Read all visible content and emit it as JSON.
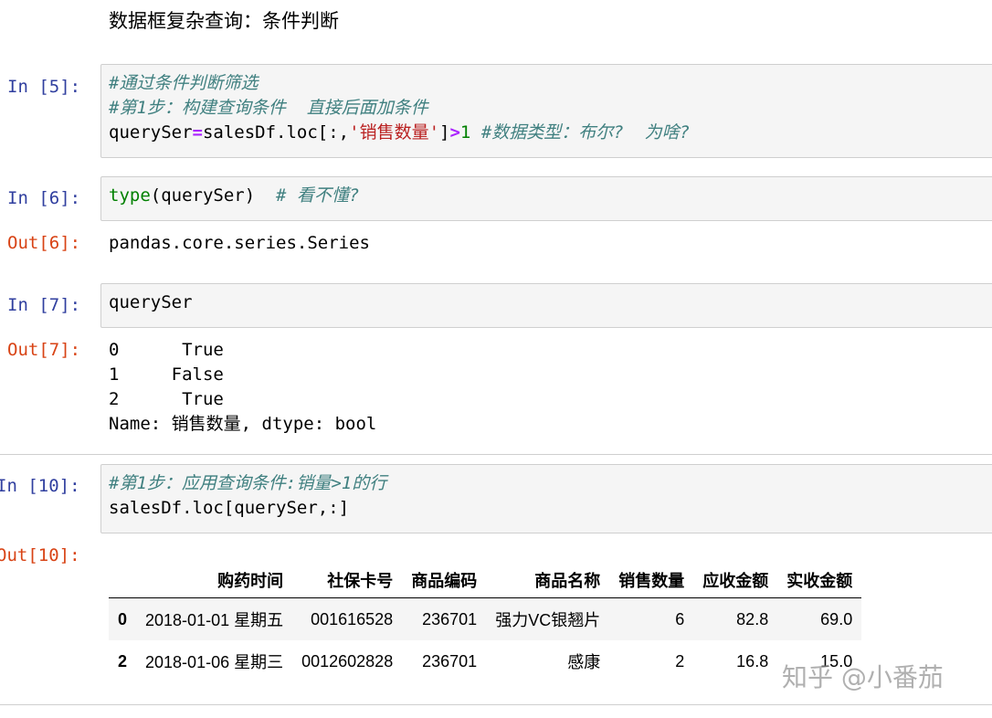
{
  "markdown_heading": "数据框复杂查询：条件判断",
  "cells": [
    {
      "in_prompt": "In [5]:",
      "line1": "#通过条件判断筛选",
      "line2": "#第1步：构建查询条件  直接后面加条件",
      "line3_var": "querySer",
      "line3_eq": "=",
      "line3_expr": "salesDf.loc[:,",
      "line3_str": "'销售数量'",
      "line3_close": "]",
      "line3_gt": ">",
      "line3_num": "1",
      "line3_comment": " #数据类型：布尔?  为啥?"
    },
    {
      "in_prompt": "In [6]:",
      "builtin": "type",
      "args": "(querySer)  ",
      "comment": "# 看不懂?",
      "out_prompt": "Out[6]:",
      "output": "pandas.core.series.Series"
    },
    {
      "in_prompt": "In [7]:",
      "code": "querySer",
      "out_prompt": "Out[7]:",
      "output_lines": [
        "0      True",
        "1     False",
        "2      True",
        "Name: 销售数量, dtype: bool"
      ]
    },
    {
      "in_prompt": "In [10]:",
      "line1": "#第1步：应用查询条件:销量>1的行",
      "line2": "salesDf.loc[querySer,:]",
      "out_prompt": "Out[10]:"
    }
  ],
  "table": {
    "columns": [
      "",
      "购药时间",
      "社保卡号",
      "商品编码",
      "商品名称",
      "销售数量",
      "应收金额",
      "实收金额"
    ],
    "rows": [
      [
        "0",
        "2018-01-01 星期五",
        "001616528",
        "236701",
        "强力VC银翘片",
        "6",
        "82.8",
        "69.0"
      ],
      [
        "2",
        "2018-01-06 星期三",
        "0012602828",
        "236701",
        "感康",
        "2",
        "16.8",
        "15.0"
      ]
    ]
  },
  "watermark": "知乎 @小番茄"
}
